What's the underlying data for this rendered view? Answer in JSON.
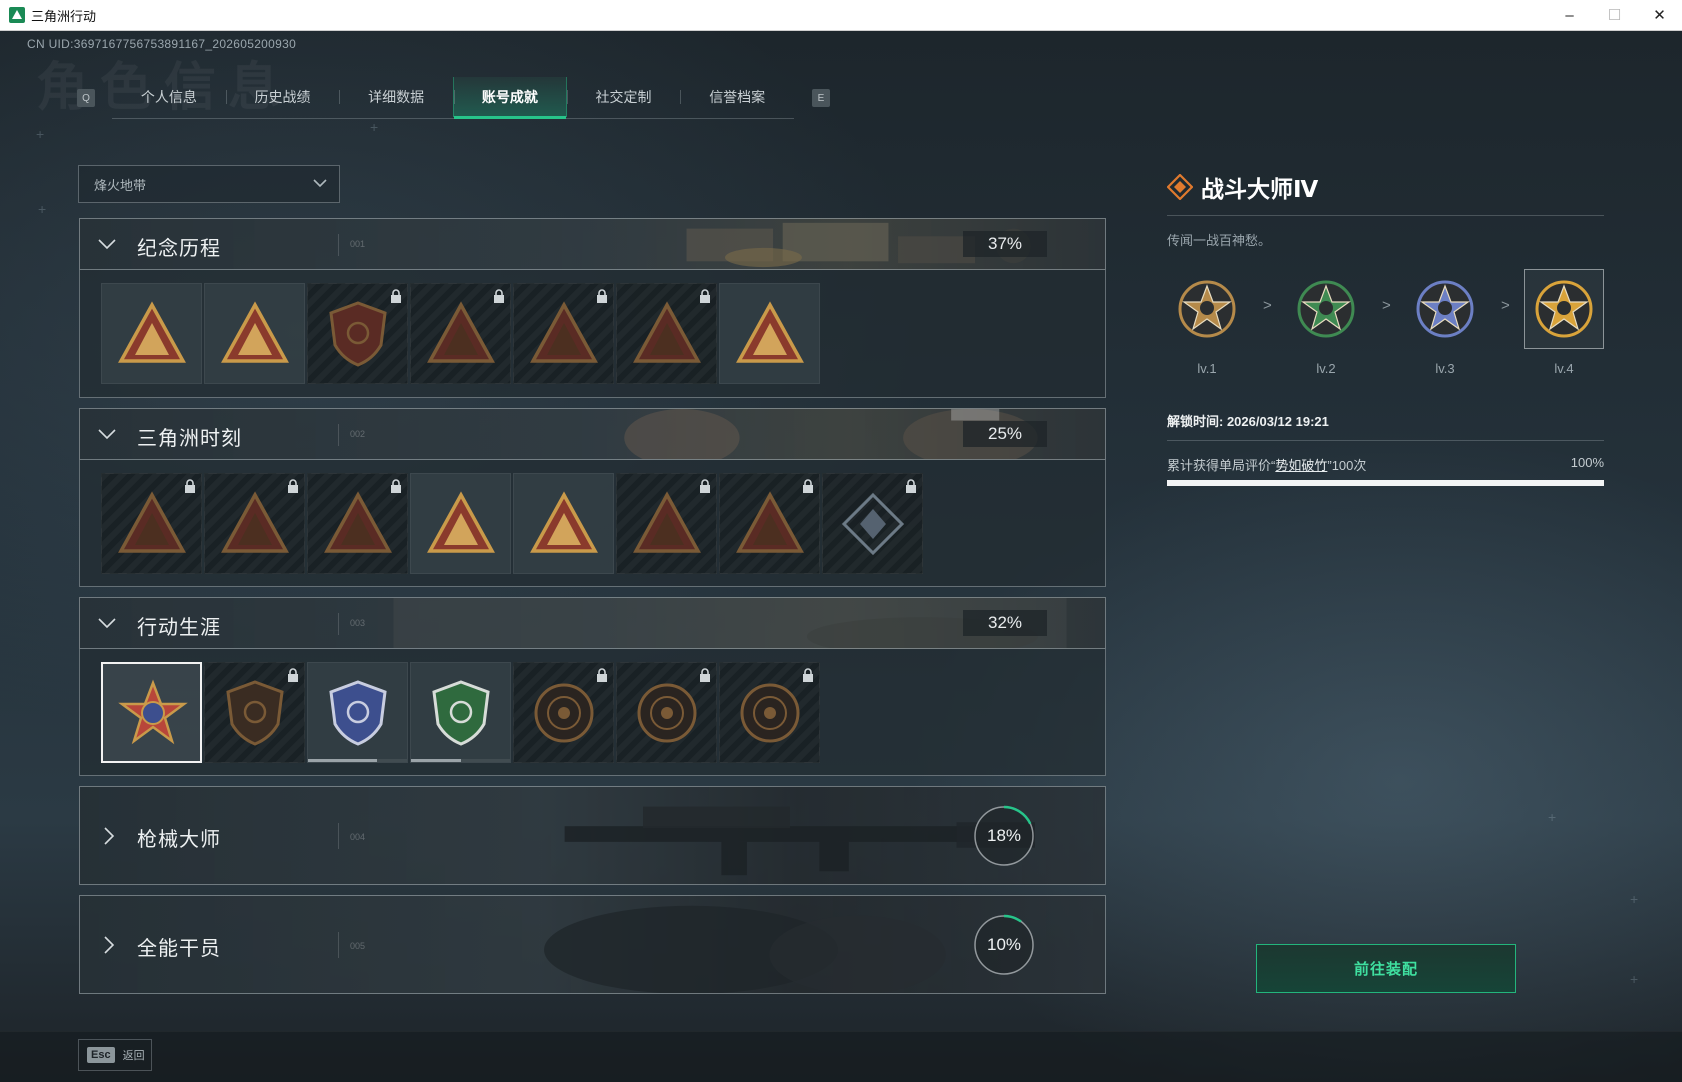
{
  "window": {
    "title": "三角洲行动",
    "minimize": "–",
    "maximize": "☐",
    "close": "✕"
  },
  "uid": "CN UID:3697167756753891167_202605200930",
  "bg_title": "角色信息",
  "tabs": {
    "key_left": "Q",
    "key_right": "E",
    "items": [
      {
        "label": "个人信息"
      },
      {
        "label": "历史战绩"
      },
      {
        "label": "详细数据"
      },
      {
        "label": "账号成就",
        "active": true
      },
      {
        "label": "社交定制"
      },
      {
        "label": "信誉档案"
      }
    ]
  },
  "mode_dropdown": {
    "value": "烽火地带"
  },
  "categories": [
    {
      "name": "纪念历程",
      "code": "001",
      "percent": "37%",
      "expanded": true,
      "badges": [
        {
          "icon": "mountain-triangle-emblem-icon",
          "locked": false
        },
        {
          "icon": "helicopter-emblem-icon",
          "locked": false
        },
        {
          "icon": "shield-hex-emblem-icon",
          "locked": true
        },
        {
          "icon": "soldier-emblem-icon",
          "locked": true
        },
        {
          "icon": "hooded-figure-emblem-icon",
          "locked": true
        },
        {
          "icon": "crossed-swords-emblem-icon",
          "locked": true
        },
        {
          "icon": "golden-leaf-emblem-icon",
          "locked": false
        }
      ]
    },
    {
      "name": "三角洲时刻",
      "code": "002",
      "percent": "25%",
      "expanded": true,
      "badges": [
        {
          "icon": "robot-emblem-icon",
          "locked": true
        },
        {
          "icon": "vault-emblem-icon",
          "locked": true
        },
        {
          "icon": "kneeling-soldier-emblem-icon",
          "locked": true
        },
        {
          "icon": "gem-triangle-emblem-icon",
          "locked": false
        },
        {
          "icon": "hero-pose-emblem-icon",
          "locked": false
        },
        {
          "icon": "beast-emblem-icon",
          "locked": true
        },
        {
          "icon": "fish-emblem-icon",
          "locked": true
        },
        {
          "icon": "diamond-cube-emblem-icon",
          "locked": true
        }
      ]
    },
    {
      "name": "行动生涯",
      "code": "003",
      "percent": "32%",
      "expanded": true,
      "badges": [
        {
          "icon": "star-medal-emblem-icon",
          "locked": false,
          "selected": true
        },
        {
          "icon": "bronze-shield-emblem-icon",
          "locked": true
        },
        {
          "icon": "blue-shield-emblem-icon",
          "locked": false,
          "progress": 0.7
        },
        {
          "icon": "green-shield-emblem-icon",
          "locked": false,
          "progress": 0.5
        },
        {
          "icon": "bronze-ring-emblem-icon",
          "locked": true
        },
        {
          "icon": "skull-ring-emblem-icon",
          "locked": true
        },
        {
          "icon": "eye-ring-emblem-icon",
          "locked": true
        }
      ]
    },
    {
      "name": "枪械大师",
      "code": "004",
      "percent": "18%",
      "progress": 0.18,
      "expanded": false
    },
    {
      "name": "全能干员",
      "code": "005",
      "percent": "10%",
      "progress": 0.1,
      "expanded": false
    }
  ],
  "detail": {
    "title": "战斗大师Ⅳ",
    "description": "传闻一战百神愁。",
    "levels": [
      {
        "label": "lv.1",
        "color": "#b58a4a"
      },
      {
        "label": "lv.2",
        "color": "#3f8a52"
      },
      {
        "label": "lv.3",
        "color": "#6c7fc4"
      },
      {
        "label": "lv.4",
        "color": "#d9a33a",
        "current": true
      }
    ],
    "arrow": ">",
    "unlock_time": "解锁时间: 2026/03/12 19:21",
    "requirement_prefix": "累计获得单局评价“",
    "requirement_keyword": "势如破竹",
    "requirement_suffix": "”100次",
    "requirement_percent": "100%",
    "requirement_progress": 1.0
  },
  "goto_button": "前往装配",
  "footer": {
    "esc_key": "Esc",
    "back_label": "返回"
  },
  "colors": {
    "accent": "#27c48a",
    "button_text": "#3fe0a0",
    "badge_gold": "#d9a33a"
  }
}
